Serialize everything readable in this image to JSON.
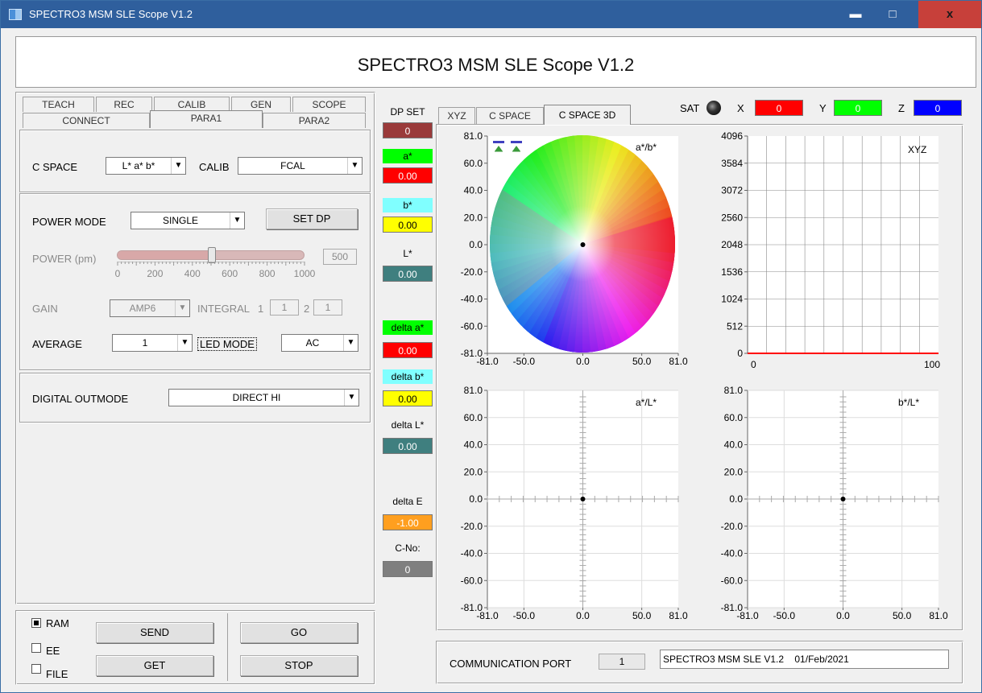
{
  "window": {
    "title": "SPECTRO3 MSM SLE Scope V1.2",
    "min": "▬",
    "max": "□",
    "close": "x"
  },
  "header": {
    "title": "SPECTRO3 MSM SLE Scope V1.2"
  },
  "tabs_top": [
    "TEACH",
    "REC",
    "CALIB",
    "GEN",
    "SCOPE"
  ],
  "tabs_bottom": [
    "CONNECT",
    "PARA1",
    "PARA2"
  ],
  "para1": {
    "cspace_label": "C SPACE",
    "cspace_value": "L* a* b*",
    "calib_label": "CALIB",
    "calib_value": "FCAL",
    "power_mode_label": "POWER MODE",
    "power_mode_value": "SINGLE",
    "set_dp": "SET DP",
    "power_label": "POWER (pm)",
    "power_value": "500",
    "power_fraction": 0.5,
    "power_ticks": [
      "0",
      "200",
      "400",
      "600",
      "800",
      "1000"
    ],
    "gain_label": "GAIN",
    "gain_value": "AMP6",
    "integral_label": "INTEGRAL",
    "integral_1_label": "1",
    "integral_1_value": "1",
    "integral_2_label": "2",
    "integral_2_value": "1",
    "average_label": "AVERAGE",
    "average_value": "1",
    "led_mode_label": "LED MODE",
    "led_mode_value": "AC",
    "digital_outmode_label": "DIGITAL OUTMODE",
    "digital_outmode_value": "DIRECT HI"
  },
  "bottom": {
    "ram": "RAM",
    "ee": "EE",
    "file": "FILE",
    "send": "SEND",
    "get": "GET",
    "go": "GO",
    "stop": "STOP",
    "ram_checked": true,
    "ee_checked": false,
    "file_checked": false
  },
  "sidebar": {
    "dp_set_label": "DP SET",
    "dp_set_value": "0",
    "a_label": "a*",
    "a_value": "0.00",
    "b_label": "b*",
    "b_value": "0.00",
    "l_label": "L*",
    "l_value": "0.00",
    "da_label": "delta a*",
    "da_value": "0.00",
    "db_label": "delta b*",
    "db_value": "0.00",
    "dl_label": "delta L*",
    "dl_value": "0.00",
    "de_label": "delta E",
    "de_value": "-1.00",
    "cno_label": "C-No:",
    "cno_value": "0"
  },
  "scope_tabs": [
    "XYZ",
    "C SPACE",
    "C SPACE 3D"
  ],
  "sat": {
    "label": "SAT",
    "x_label": "X",
    "x_value": "0",
    "y_label": "Y",
    "y_value": "0",
    "z_label": "Z",
    "z_value": "0"
  },
  "colors": {
    "red": "#ff0000",
    "green": "#00ff00",
    "blue": "#0000ff",
    "yellow": "#ffff00",
    "cyan": "#80ffff",
    "teal": "#3f7f7f",
    "orange": "#ff9f1f",
    "gray": "#7f7f7f",
    "darkred": "#9a3a3a"
  },
  "plot_ab": {
    "title": "a*/b*",
    "y_ticks": [
      "81.0",
      "60.0",
      "40.0",
      "20.0",
      "0.0",
      "-20.0",
      "-40.0",
      "-60.0",
      "-81.0"
    ],
    "x_ticks": [
      "-81.0",
      "-50.0",
      "0.0",
      "50.0",
      "81.0"
    ],
    "point": {
      "a": 0,
      "b": 0
    }
  },
  "plot_xyz": {
    "title": "XYZ",
    "y_ticks": [
      "4096",
      "3584",
      "3072",
      "2560",
      "2048",
      "1536",
      "1024",
      "512",
      "0"
    ],
    "x_ticks": [
      "0",
      "100"
    ],
    "values": {
      "X": 0,
      "Y": 0,
      "Z": 0
    }
  },
  "plot_al": {
    "title": "a*/L*",
    "y_ticks": [
      "81.0",
      "60.0",
      "40.0",
      "20.0",
      "0.0",
      "-20.0",
      "-40.0",
      "-60.0",
      "-81.0"
    ],
    "x_ticks": [
      "-81.0",
      "-50.0",
      "0.0",
      "50.0",
      "81.0"
    ],
    "point": {
      "a": 0,
      "L": 0
    }
  },
  "plot_bl": {
    "title": "b*/L*",
    "y_ticks": [
      "81.0",
      "60.0",
      "40.0",
      "20.0",
      "0.0",
      "-20.0",
      "-40.0",
      "-60.0",
      "-81.0"
    ],
    "x_ticks": [
      "-81.0",
      "-50.0",
      "0.0",
      "50.0",
      "81.0"
    ],
    "point": {
      "b": 0,
      "L": 0
    }
  },
  "comm": {
    "label": "COMMUNICATION PORT",
    "port": "1",
    "status": "SPECTRO3 MSM SLE V1.2    01/Feb/2021"
  }
}
